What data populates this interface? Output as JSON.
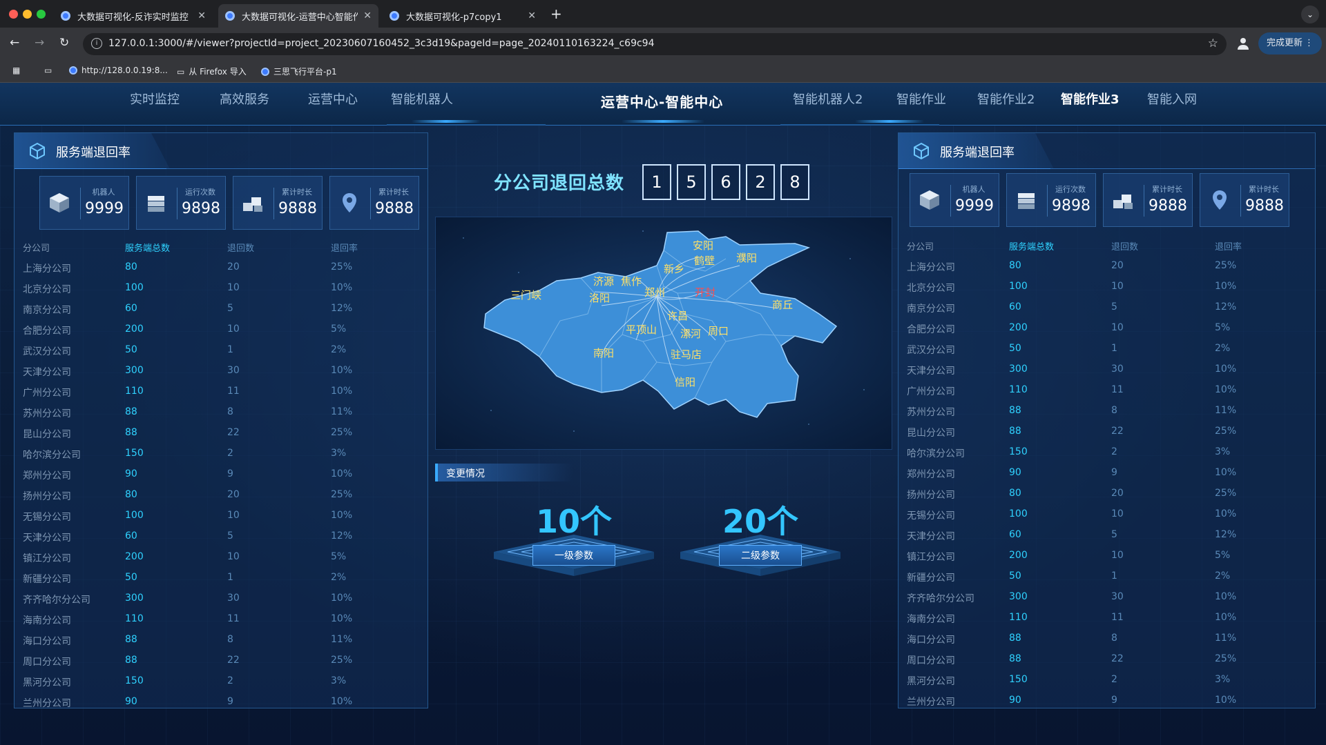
{
  "browser": {
    "tabs": [
      {
        "title": "大数据可视化-反诈实时监控"
      },
      {
        "title": "大数据可视化-运营中心智能作业"
      },
      {
        "title": "大数据可视化-p7copy1"
      }
    ],
    "url": "127.0.0.1:3000/#/viewer?projectId=project_20230607160452_3c3d19&pageId=page_20240110163224_c69c94",
    "update_button": "完成更新",
    "bookmarks": [
      {
        "label": "http://128.0.0.19:8..."
      },
      {
        "label": "从 Firefox 导入"
      },
      {
        "label": "三思飞行平台-p1"
      }
    ]
  },
  "nav": {
    "left": [
      "实时监控",
      "高效服务",
      "运营中心",
      "智能机器人"
    ],
    "title": "运营中心-智能中心",
    "right": [
      "智能机器人2",
      "智能作业",
      "智能作业2",
      "智能作业3",
      "智能入网"
    ],
    "active": "智能作业3"
  },
  "left_panel": {
    "title": "服务端退回率",
    "stats": [
      {
        "label": "机器人",
        "value": "9999",
        "icon": "robot-cube-icon"
      },
      {
        "label": "运行次数",
        "value": "9898",
        "icon": "server-stack-icon"
      },
      {
        "label": "累计时长",
        "value": "9888",
        "icon": "blocks-icon"
      },
      {
        "label": "累计时长",
        "value": "9888",
        "icon": "location-pin-icon"
      }
    ],
    "columns": [
      "分公司",
      "服务端总数",
      "退回数",
      "退回率"
    ],
    "rows": [
      [
        "上海分公司",
        "80",
        "20",
        "25%"
      ],
      [
        "北京分公司",
        "100",
        "10",
        "10%"
      ],
      [
        "南京分公司",
        "60",
        "5",
        "12%"
      ],
      [
        "合肥分公司",
        "200",
        "10",
        "5%"
      ],
      [
        "武汉分公司",
        "50",
        "1",
        "2%"
      ],
      [
        "天津分公司",
        "300",
        "30",
        "10%"
      ],
      [
        "广州分公司",
        "110",
        "11",
        "10%"
      ],
      [
        "苏州分公司",
        "88",
        "8",
        "11%"
      ],
      [
        "昆山分公司",
        "88",
        "22",
        "25%"
      ],
      [
        "哈尔滨分公司",
        "150",
        "2",
        "3%"
      ],
      [
        "郑州分公司",
        "90",
        "9",
        "10%"
      ],
      [
        "扬州分公司",
        "80",
        "20",
        "25%"
      ],
      [
        "无锡分公司",
        "100",
        "10",
        "10%"
      ],
      [
        "天津分公司",
        "60",
        "5",
        "12%"
      ],
      [
        "镇江分公司",
        "200",
        "10",
        "5%"
      ],
      [
        "新疆分公司",
        "50",
        "1",
        "2%"
      ],
      [
        "齐齐哈尔分公司",
        "300",
        "30",
        "10%"
      ],
      [
        "海南分公司",
        "110",
        "11",
        "10%"
      ],
      [
        "海口分公司",
        "88",
        "8",
        "11%"
      ],
      [
        "周口分公司",
        "88",
        "22",
        "25%"
      ],
      [
        "黑河分公司",
        "150",
        "2",
        "3%"
      ],
      [
        "兰州分公司",
        "90",
        "9",
        "10%"
      ]
    ]
  },
  "right_panel": {
    "title": "服务端退回率",
    "stats": [
      {
        "label": "机器人",
        "value": "9999",
        "icon": "robot-cube-icon"
      },
      {
        "label": "运行次数",
        "value": "9898",
        "icon": "server-stack-icon"
      },
      {
        "label": "累计时长",
        "value": "9888",
        "icon": "blocks-icon"
      },
      {
        "label": "累计时长",
        "value": "9888",
        "icon": "location-pin-icon"
      }
    ],
    "columns": [
      "分公司",
      "服务端总数",
      "退回数",
      "退回率"
    ],
    "rows": [
      [
        "上海分公司",
        "80",
        "20",
        "25%"
      ],
      [
        "北京分公司",
        "100",
        "10",
        "10%"
      ],
      [
        "南京分公司",
        "60",
        "5",
        "12%"
      ],
      [
        "合肥分公司",
        "200",
        "10",
        "5%"
      ],
      [
        "武汉分公司",
        "50",
        "1",
        "2%"
      ],
      [
        "天津分公司",
        "300",
        "30",
        "10%"
      ],
      [
        "广州分公司",
        "110",
        "11",
        "10%"
      ],
      [
        "苏州分公司",
        "88",
        "8",
        "11%"
      ],
      [
        "昆山分公司",
        "88",
        "22",
        "25%"
      ],
      [
        "哈尔滨分公司",
        "150",
        "2",
        "3%"
      ],
      [
        "郑州分公司",
        "90",
        "9",
        "10%"
      ],
      [
        "扬州分公司",
        "80",
        "20",
        "25%"
      ],
      [
        "无锡分公司",
        "100",
        "10",
        "10%"
      ],
      [
        "天津分公司",
        "60",
        "5",
        "12%"
      ],
      [
        "镇江分公司",
        "200",
        "10",
        "5%"
      ],
      [
        "新疆分公司",
        "50",
        "1",
        "2%"
      ],
      [
        "齐齐哈尔分公司",
        "300",
        "30",
        "10%"
      ],
      [
        "海南分公司",
        "110",
        "11",
        "10%"
      ],
      [
        "海口分公司",
        "88",
        "8",
        "11%"
      ],
      [
        "周口分公司",
        "88",
        "22",
        "25%"
      ],
      [
        "黑河分公司",
        "150",
        "2",
        "3%"
      ],
      [
        "兰州分公司",
        "90",
        "9",
        "10%"
      ]
    ]
  },
  "center": {
    "total_label": "分公司退回总数",
    "digits": [
      "1",
      "5",
      "6",
      "2",
      "8"
    ],
    "map_cities": [
      "安阳",
      "鹤壁",
      "濮阳",
      "新乡",
      "济源",
      "焦作",
      "郑州",
      "开封",
      "三门峡",
      "洛阳",
      "商丘",
      "许昌",
      "平顶山",
      "漯河",
      "周口",
      "南阳",
      "驻马店",
      "信阳"
    ],
    "highlight_city": "开封",
    "change_label": "变更情况",
    "params": [
      {
        "value": "10个",
        "label": "一级参数"
      },
      {
        "value": "20个",
        "label": "二级参数"
      }
    ]
  },
  "colors": {
    "accent": "#2fd2ff",
    "map_fill": "#3d8fd8",
    "city_label": "#ffe066",
    "highlight": "#ff4d4d"
  }
}
